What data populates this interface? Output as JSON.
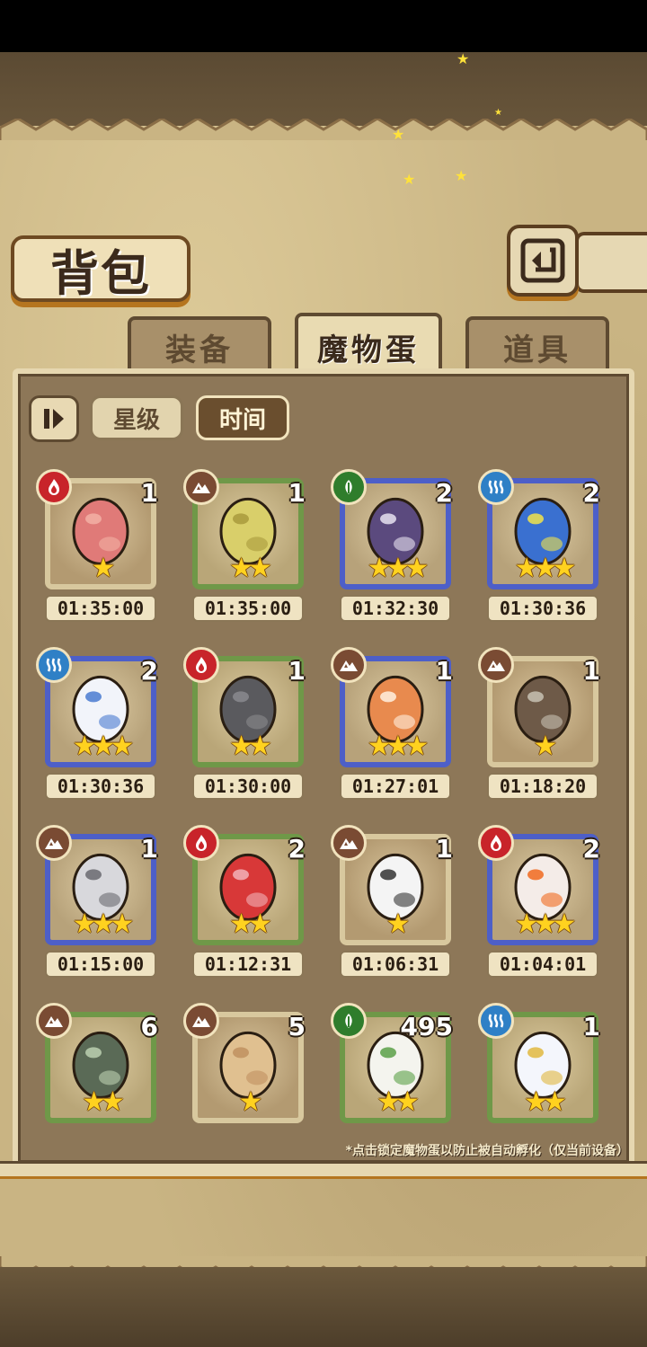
{
  "title": "背包",
  "tabs": [
    {
      "label": "装备",
      "active": false
    },
    {
      "label": "魔物蛋",
      "active": true
    },
    {
      "label": "道具",
      "active": false
    }
  ],
  "sort": {
    "star_label": "星级",
    "time_label": "时间",
    "active": "时间"
  },
  "footnote": "*点击锁定魔物蛋以防止被自动孵化（仅当前设备）",
  "colors": {
    "fire": "#c8242a",
    "earth": "#7a4b33",
    "nature": "#2f7d2c",
    "water": "#2f80c6"
  },
  "eggs": [
    {
      "element": "fire-icon",
      "count": "1",
      "stars": 1,
      "frame": "brown",
      "timer": "01:35:00",
      "art": "pink-slime-egg"
    },
    {
      "element": "earth-icon",
      "count": "1",
      "stars": 2,
      "frame": "green",
      "timer": "01:35:00",
      "art": "cracked-yellow-egg"
    },
    {
      "element": "nature-icon",
      "count": "2",
      "stars": 3,
      "frame": "blue",
      "timer": "01:32:30",
      "art": "purple-egg"
    },
    {
      "element": "water-icon",
      "count": "2",
      "stars": 3,
      "frame": "blue",
      "timer": "01:30:36",
      "art": "blue-eye-egg"
    },
    {
      "element": "water-icon",
      "count": "2",
      "stars": 3,
      "frame": "blue",
      "timer": "01:30:36",
      "art": "sailor-egg"
    },
    {
      "element": "fire-icon",
      "count": "1",
      "stars": 2,
      "frame": "green",
      "timer": "01:30:00",
      "art": "stone-egg"
    },
    {
      "element": "earth-icon",
      "count": "1",
      "stars": 3,
      "frame": "blue",
      "timer": "01:27:01",
      "art": "fox-egg"
    },
    {
      "element": "earth-icon",
      "count": "1",
      "stars": 1,
      "frame": "brown",
      "timer": "01:18:20",
      "art": "mushroom-egg"
    },
    {
      "element": "earth-icon",
      "count": "1",
      "stars": 3,
      "frame": "blue",
      "timer": "01:15:00",
      "art": "cleaver-egg"
    },
    {
      "element": "fire-icon",
      "count": "2",
      "stars": 2,
      "frame": "green",
      "timer": "01:12:31",
      "art": "red-swirl-egg"
    },
    {
      "element": "earth-icon",
      "count": "1",
      "stars": 1,
      "frame": "brown",
      "timer": "01:06:31",
      "art": "white-egg"
    },
    {
      "element": "fire-icon",
      "count": "2",
      "stars": 3,
      "frame": "blue",
      "timer": "01:04:01",
      "art": "flame-egg"
    },
    {
      "element": "earth-icon",
      "count": "6",
      "stars": 2,
      "frame": "green",
      "timer": "",
      "art": "leaf-egg"
    },
    {
      "element": "earth-icon",
      "count": "5",
      "stars": 1,
      "frame": "brown",
      "timer": "",
      "art": "tan-slime-egg"
    },
    {
      "element": "nature-icon",
      "count": "495",
      "stars": 2,
      "frame": "green",
      "timer": "",
      "art": "turnip"
    },
    {
      "element": "water-icon",
      "count": "1",
      "stars": 2,
      "frame": "green",
      "timer": "",
      "art": "cloud-egg"
    }
  ]
}
